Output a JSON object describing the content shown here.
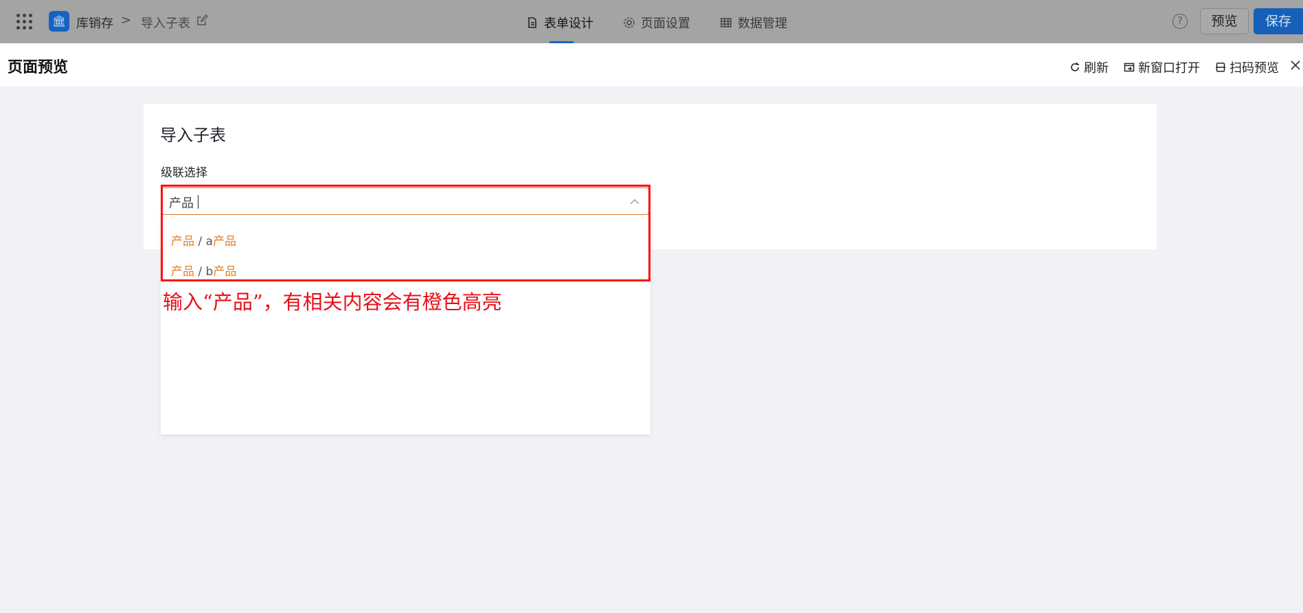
{
  "header": {
    "app_name": "库销存",
    "breadcrumb_sep": ">",
    "page_name": "导入子表",
    "tabs": [
      {
        "label": "表单设计",
        "active": true
      },
      {
        "label": "页面设置",
        "active": false
      },
      {
        "label": "数据管理",
        "active": false
      }
    ],
    "help_label": "?",
    "preview_label": "预览",
    "save_label": "保存",
    "accent_color": "#1565c0"
  },
  "preview_panel": {
    "title": "页面预览",
    "actions": {
      "refresh": "刷新",
      "open_new_window": "新窗口打开",
      "scan_preview": "扫码预览"
    }
  },
  "form": {
    "title": "导入子表",
    "field_label": "级联选择",
    "search_value": "产品",
    "options": [
      {
        "parts": [
          "产品",
          " / a",
          "产品"
        ]
      },
      {
        "parts": [
          "产品",
          " / b",
          "产品"
        ]
      }
    ],
    "highlight_color": "#e67e22"
  },
  "annotation": {
    "text": "输入“产品”，有相关内容会有橙色高亮",
    "color": "#ff0a0a"
  }
}
